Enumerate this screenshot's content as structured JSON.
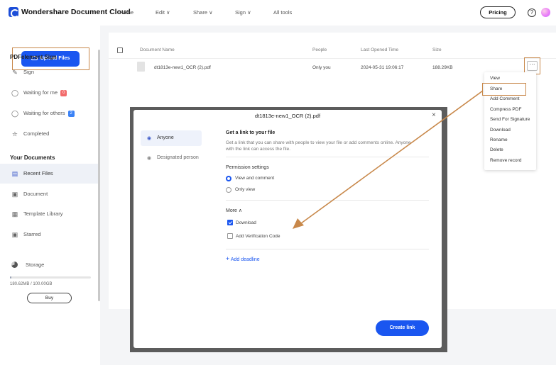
{
  "app": {
    "title": "Wondershare Document Cloud"
  },
  "nav": [
    {
      "label": "Home"
    },
    {
      "label": "Edit ∨"
    },
    {
      "label": "Share ∨"
    },
    {
      "label": "Sign ∨"
    },
    {
      "label": "All tools"
    }
  ],
  "header": {
    "pricing_label": "Pricing",
    "help_glyph": "?"
  },
  "sidebar": {
    "upload_label": "Upload Files",
    "sign_section_title": "PDFelement Sign",
    "sign_items": [
      {
        "label": "Sign",
        "icon": "pen-icon"
      },
      {
        "label": "Waiting for me",
        "badge": "0",
        "badge_color": "#f26b6b",
        "icon": "person-icon"
      },
      {
        "label": "Waiting for others",
        "badge": "2",
        "badge_color": "#3b82f6",
        "icon": "people-icon"
      },
      {
        "label": "Completed",
        "icon": "shield-icon"
      }
    ],
    "docs_section_title": "Your Documents",
    "doc_items": [
      {
        "label": "Recent Files",
        "icon": "recent-files-icon"
      },
      {
        "label": "Document",
        "icon": "document-icon"
      },
      {
        "label": "Template Library",
        "icon": "template-icon"
      },
      {
        "label": "Starred",
        "icon": "star-icon"
      }
    ],
    "storage": {
      "label": "Storage",
      "used_text": "180.62MB / 100.00GB",
      "used_fraction": 0.002
    },
    "buy_label": "Buy"
  },
  "table": {
    "headers": {
      "name": "Document Name",
      "people": "People",
      "opened": "Last Opened Time",
      "size": "Size"
    },
    "rows": [
      {
        "name": "dt1813e-new1_OCR (2).pdf",
        "people": "Only you",
        "opened": "2024-05-31 19:06:17",
        "size": "188.29KB"
      }
    ],
    "more_glyph": "···"
  },
  "context_menu": {
    "items": [
      "View",
      "Share",
      "Add Comment",
      "Compress PDF",
      "Send For Signature",
      "Download",
      "Rename",
      "Delete",
      "Remove record"
    ]
  },
  "modal": {
    "title": "dt1813e-new1_OCR (2).pdf",
    "close_glyph": "×",
    "tabs": [
      {
        "label": "Anyone"
      },
      {
        "label": "Designated person"
      }
    ],
    "link_heading": "Get a link to your file",
    "link_desc": "Get a link that you can share with people to view your file or add comments online. Anyone with the link can access the file.",
    "permission_heading": "Permission settings",
    "permissions": [
      {
        "label": "View and comment",
        "selected": true
      },
      {
        "label": "Only view",
        "selected": false
      }
    ],
    "more_label": "More ∧",
    "options": [
      {
        "label": "Download",
        "checked": true
      },
      {
        "label": "Add Verification Code",
        "checked": false
      }
    ],
    "deadline_label": "Add deadline",
    "create_label": "Create link"
  },
  "colors": {
    "accent": "#1a56f0",
    "annotation": "#c8884a"
  }
}
